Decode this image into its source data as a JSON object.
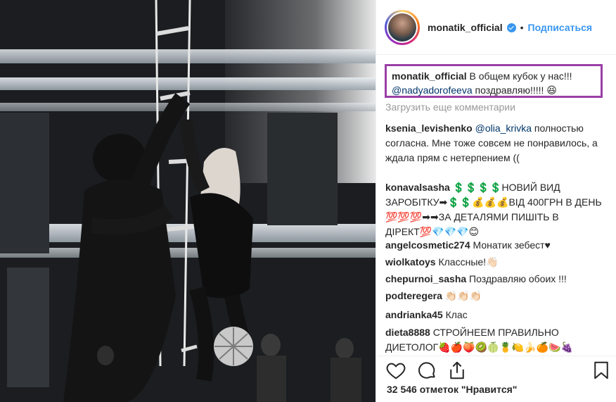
{
  "post": {
    "username": "monatik_official",
    "follow_label": "Подписаться",
    "dot": "•"
  },
  "caption": {
    "username": "monatik_official",
    "text_line1": "В общем кубок у нас!!!",
    "mention": "@nadyadorofeeva",
    "text_line2": "поздравляю!!!!! 😆"
  },
  "load_more": "Загрузить еще комментарии",
  "comments": [
    {
      "username": "ksenia_levishenko",
      "mention": "@olia_krivka",
      "text": "полностью согласна. Мне тоже совсем не понравилось, а ждала прям с нетерпением (("
    },
    {
      "username": "konavalsasha",
      "text": "💲💲💲💲НОВИЙ ВИД ЗАРОБІТКУ➡💲💲💰💰💰ВІД 400ГРН В ДЕНЬ 💯💯💯➡➡ЗА ДЕТАЛЯМИ ПИШІТЬ В ДІРЕКТ💯💎💎💎😊"
    },
    {
      "username": "angelcosmetic274",
      "text": "Монатик зебест♥"
    },
    {
      "username": "wiolkatoys",
      "text": "Классные!👋🏻"
    },
    {
      "username": "chepurnoi_sasha",
      "text": "Поздравляю обоих !!!"
    },
    {
      "username": "podteregera",
      "text": "👏🏻👏🏻👏🏻"
    },
    {
      "username": "andrianka45",
      "text": "Клас"
    },
    {
      "username": "dieta8888",
      "text": "СТРОЙНЕЕМ ПРАВИЛЬНО ДИЕТОЛОГ🍓🍎🍑🥝🍈🍍🍋🍌🍊🍉🍇"
    }
  ],
  "likes": "32 546 отметок \"Нравится\"",
  "icons": {
    "like": "heart-icon",
    "comment": "comment-icon",
    "share": "share-icon",
    "save": "bookmark-icon",
    "verified": "verified-badge-icon"
  },
  "colors": {
    "accent": "#3897f0",
    "highlight_border": "#9b3fa6",
    "muted": "#999999",
    "mention": "#003569"
  }
}
